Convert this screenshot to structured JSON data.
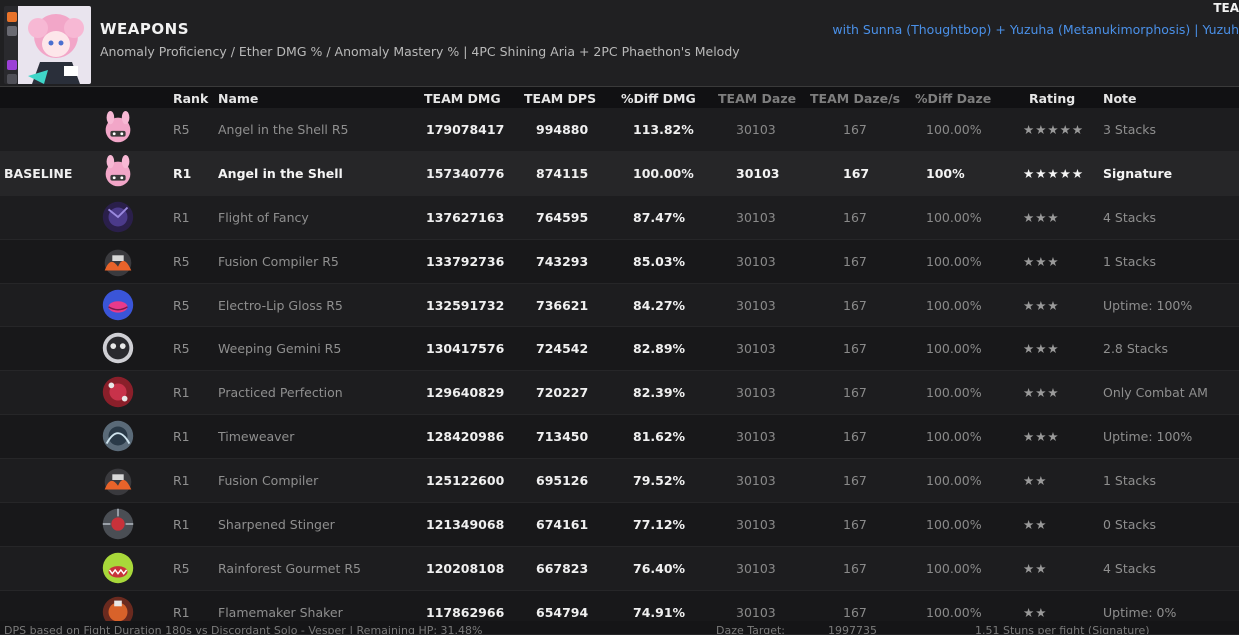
{
  "header": {
    "title": "WEAPONS",
    "subtitle": "Anomaly Proficiency / Ether DMG % / Anomaly Mastery %   |   4PC Shining Aria + 2PC Phaethon's Melody",
    "team": "with Sunna (Thoughtbop) + Yuzuha (Metanukimorphosis) | Yuzuh",
    "corner": "TEA"
  },
  "columns": {
    "rank": "Rank",
    "name": "Name",
    "team_dmg": "TEAM DMG",
    "team_dps": "TEAM DPS",
    "diff_dmg": "%Diff DMG",
    "team_daze": "TEAM Daze",
    "team_daze_s": "TEAM Daze/s",
    "diff_daze": "%Diff Daze",
    "rating": "Rating",
    "note": "Note"
  },
  "rows": [
    {
      "label": "",
      "icon": "bunny-icon",
      "rank": "R5",
      "name": "Angel in the Shell R5",
      "dmg": "179078417",
      "dps": "994880",
      "diff": "113.82%",
      "daze": "30103",
      "dazes": "167",
      "diffdaze": "100.00%",
      "rating": "★★★★★",
      "note": "3 Stacks"
    },
    {
      "label": "BASELINE",
      "icon": "bunny-icon",
      "rank": "R1",
      "name": "Angel in the Shell",
      "dmg": "157340776",
      "dps": "874115",
      "diff": "100.00%",
      "daze": "30103",
      "dazes": "167",
      "diffdaze": "100%",
      "rating": "★★★★★",
      "note": "Signature"
    },
    {
      "label": "",
      "icon": "dark-orb-icon",
      "rank": "R1",
      "name": "Flight of Fancy",
      "dmg": "137627163",
      "dps": "764595",
      "diff": "87.47%",
      "daze": "30103",
      "dazes": "167",
      "diffdaze": "100.00%",
      "rating": "★★★",
      "note": "4 Stacks"
    },
    {
      "label": "",
      "icon": "fire-machine-icon",
      "rank": "R5",
      "name": "Fusion Compiler R5",
      "dmg": "133792736",
      "dps": "743293",
      "diff": "85.03%",
      "daze": "30103",
      "dazes": "167",
      "diffdaze": "100.00%",
      "rating": "★★★",
      "note": "1 Stacks"
    },
    {
      "label": "",
      "icon": "lips-icon",
      "rank": "R5",
      "name": "Electro-Lip Gloss R5",
      "dmg": "132591732",
      "dps": "736621",
      "diff": "84.27%",
      "daze": "30103",
      "dazes": "167",
      "diffdaze": "100.00%",
      "rating": "★★★",
      "note": "Uptime: 100%"
    },
    {
      "label": "",
      "icon": "gemini-orb-icon",
      "rank": "R5",
      "name": "Weeping Gemini R5",
      "dmg": "130417576",
      "dps": "724542",
      "diff": "82.89%",
      "daze": "30103",
      "dazes": "167",
      "diffdaze": "100.00%",
      "rating": "★★★",
      "note": "2.8 Stacks"
    },
    {
      "label": "",
      "icon": "red-orb-icon",
      "rank": "R1",
      "name": "Practiced Perfection",
      "dmg": "129640829",
      "dps": "720227",
      "diff": "82.39%",
      "daze": "30103",
      "dazes": "167",
      "diffdaze": "100.00%",
      "rating": "★★★",
      "note": "Only Combat AM"
    },
    {
      "label": "",
      "icon": "timeweaver-icon",
      "rank": "R1",
      "name": "Timeweaver",
      "dmg": "128420986",
      "dps": "713450",
      "diff": "81.62%",
      "daze": "30103",
      "dazes": "167",
      "diffdaze": "100.00%",
      "rating": "★★★",
      "note": "Uptime: 100%"
    },
    {
      "label": "",
      "icon": "fire-machine-icon",
      "rank": "R1",
      "name": "Fusion Compiler",
      "dmg": "125122600",
      "dps": "695126",
      "diff": "79.52%",
      "daze": "30103",
      "dazes": "167",
      "diffdaze": "100.00%",
      "rating": "★★",
      "note": "1 Stacks"
    },
    {
      "label": "",
      "icon": "stinger-icon",
      "rank": "R1",
      "name": "Sharpened Stinger",
      "dmg": "121349068",
      "dps": "674161",
      "diff": "77.12%",
      "daze": "30103",
      "dazes": "167",
      "diffdaze": "100.00%",
      "rating": "★★",
      "note": "0 Stacks"
    },
    {
      "label": "",
      "icon": "green-monster-icon",
      "rank": "R5",
      "name": "Rainforest Gourmet R5",
      "dmg": "120208108",
      "dps": "667823",
      "diff": "76.40%",
      "daze": "30103",
      "dazes": "167",
      "diffdaze": "100.00%",
      "rating": "★★",
      "note": "4 Stacks"
    },
    {
      "label": "",
      "icon": "flame-shaker-icon",
      "rank": "R1",
      "name": "Flamemaker Shaker",
      "dmg": "117862966",
      "dps": "654794",
      "diff": "74.91%",
      "daze": "30103",
      "dazes": "167",
      "diffdaze": "100.00%",
      "rating": "★★",
      "note": "Uptime: 0%"
    }
  ],
  "footer": {
    "left": "DPS based on Fight Duration 180s vs Discordant Solo - Vesper | Remaining HP: 31.48%",
    "daze_label": "Daze Target:",
    "daze_value": "1997735",
    "stuns": "1.51 Stuns per fight (Signature)"
  },
  "colors": {
    "accent": "#4a90e8",
    "background": "#1c1c1e",
    "header_bg": "#111113"
  }
}
